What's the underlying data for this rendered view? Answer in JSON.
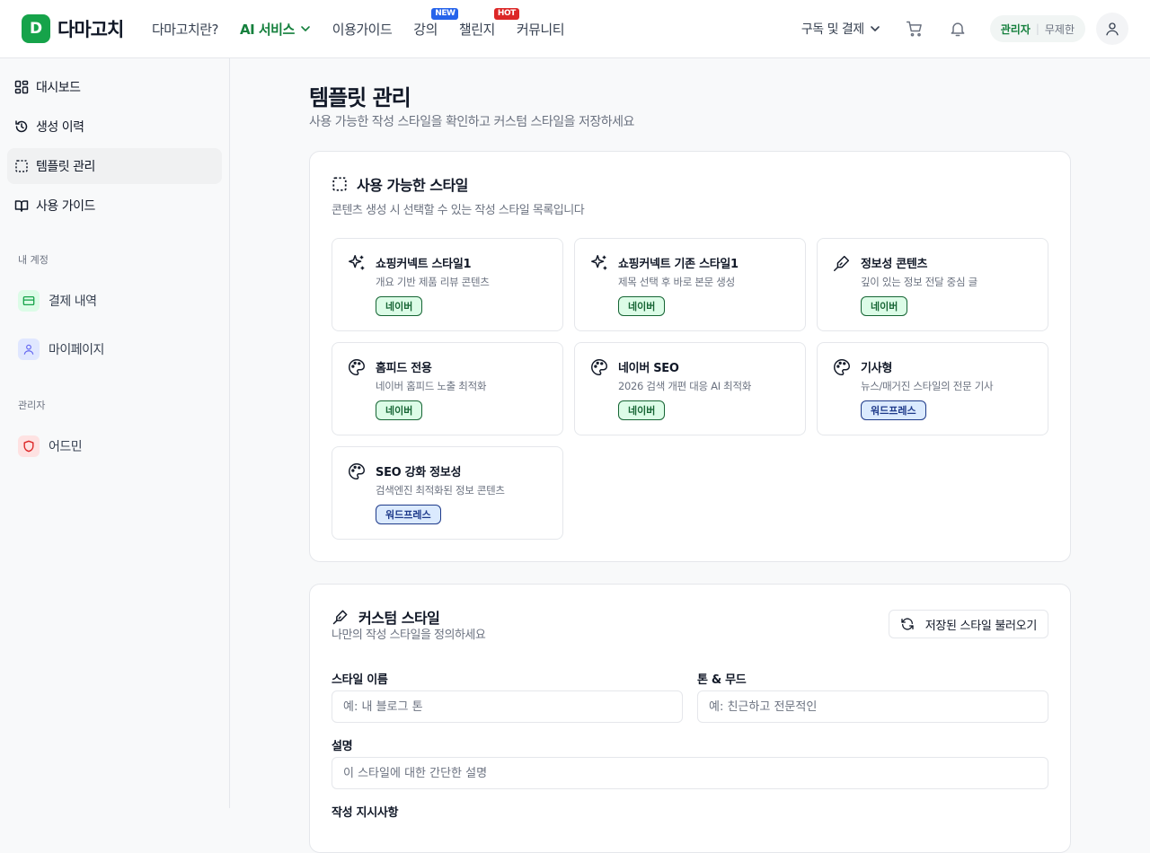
{
  "header": {
    "logo_letter": "D",
    "logo_text": "다마고치",
    "nav": [
      {
        "label": "다마고치란?"
      },
      {
        "label": "AI 서비스"
      },
      {
        "label": "이용가이드"
      },
      {
        "label": "강의",
        "badge": "NEW"
      },
      {
        "label": "챌린지",
        "badge": "HOT"
      },
      {
        "label": "커뮤니티"
      }
    ],
    "subscribe_label": "구독 및 결제",
    "role": "관리자",
    "plan": "무제한"
  },
  "sidebar": {
    "items": [
      {
        "label": "대시보드",
        "icon": "dashboard-icon"
      },
      {
        "label": "생성 이력",
        "icon": "history-icon"
      },
      {
        "label": "템플릿 관리",
        "icon": "template-icon"
      },
      {
        "label": "사용 가이드",
        "icon": "book-icon"
      }
    ],
    "account_section": "내 계정",
    "account_items": [
      {
        "label": "결제 내역",
        "icon": "card-icon"
      },
      {
        "label": "마이페이지",
        "icon": "user-icon"
      }
    ],
    "admin_section": "관리자",
    "admin_items": [
      {
        "label": "어드민",
        "icon": "shield-icon"
      }
    ]
  },
  "page": {
    "title": "템플릿 관리",
    "description": "사용 가능한 작성 스타일을 확인하고 커스텀 스타일을 저장하세요"
  },
  "styles_card": {
    "title": "사용 가능한 스타일",
    "description": "콘텐츠 생성 시 선택할 수 있는 작성 스타일 목록입니다",
    "styles": [
      {
        "title": "쇼핑커넥트 스타일1",
        "desc": "개요 기반 제품 리뷰 콘텐츠",
        "tag": "네이버",
        "icon": "sparkles-icon"
      },
      {
        "title": "쇼핑커넥트 기존 스타일1",
        "desc": "제목 선택 후 바로 본문 생성",
        "tag": "네이버",
        "icon": "sparkles-icon"
      },
      {
        "title": "정보성 콘텐츠",
        "desc": "깊이 있는 정보 전달 중심 글",
        "tag": "네이버",
        "icon": "pen-icon"
      },
      {
        "title": "홈피드 전용",
        "desc": "네이버 홈피드 노출 최적화",
        "tag": "네이버",
        "icon": "palette-icon"
      },
      {
        "title": "네이버 SEO",
        "desc": "2026 검색 개편 대응 AI 최적화",
        "tag": "네이버",
        "icon": "palette-icon"
      },
      {
        "title": "기사형",
        "desc": "뉴스/매거진 스타일의 전문 기사",
        "tag": "워드프레스",
        "icon": "palette-icon"
      },
      {
        "title": "SEO 강화 정보성",
        "desc": "검색엔진 최적화된 정보 콘텐츠",
        "tag": "워드프레스",
        "icon": "palette-icon"
      }
    ]
  },
  "custom_card": {
    "title": "커스텀 스타일",
    "description": "나만의 작성 스타일을 정의하세요",
    "load_button": "저장된 스타일 불러오기",
    "fields": {
      "name_label": "스타일 이름",
      "name_placeholder": "예: 내 블로그 톤",
      "tone_label": "톤 & 무드",
      "tone_placeholder": "예: 친근하고 전문적인",
      "desc_label": "설명",
      "desc_placeholder": "이 스타일에 대한 간단한 설명",
      "guide_label": "작성 지시사항"
    }
  },
  "colors": {
    "brand": "#16a34a",
    "naver_tag_bg": "#dcfce7",
    "wp_tag_bg": "#dbeafe"
  }
}
